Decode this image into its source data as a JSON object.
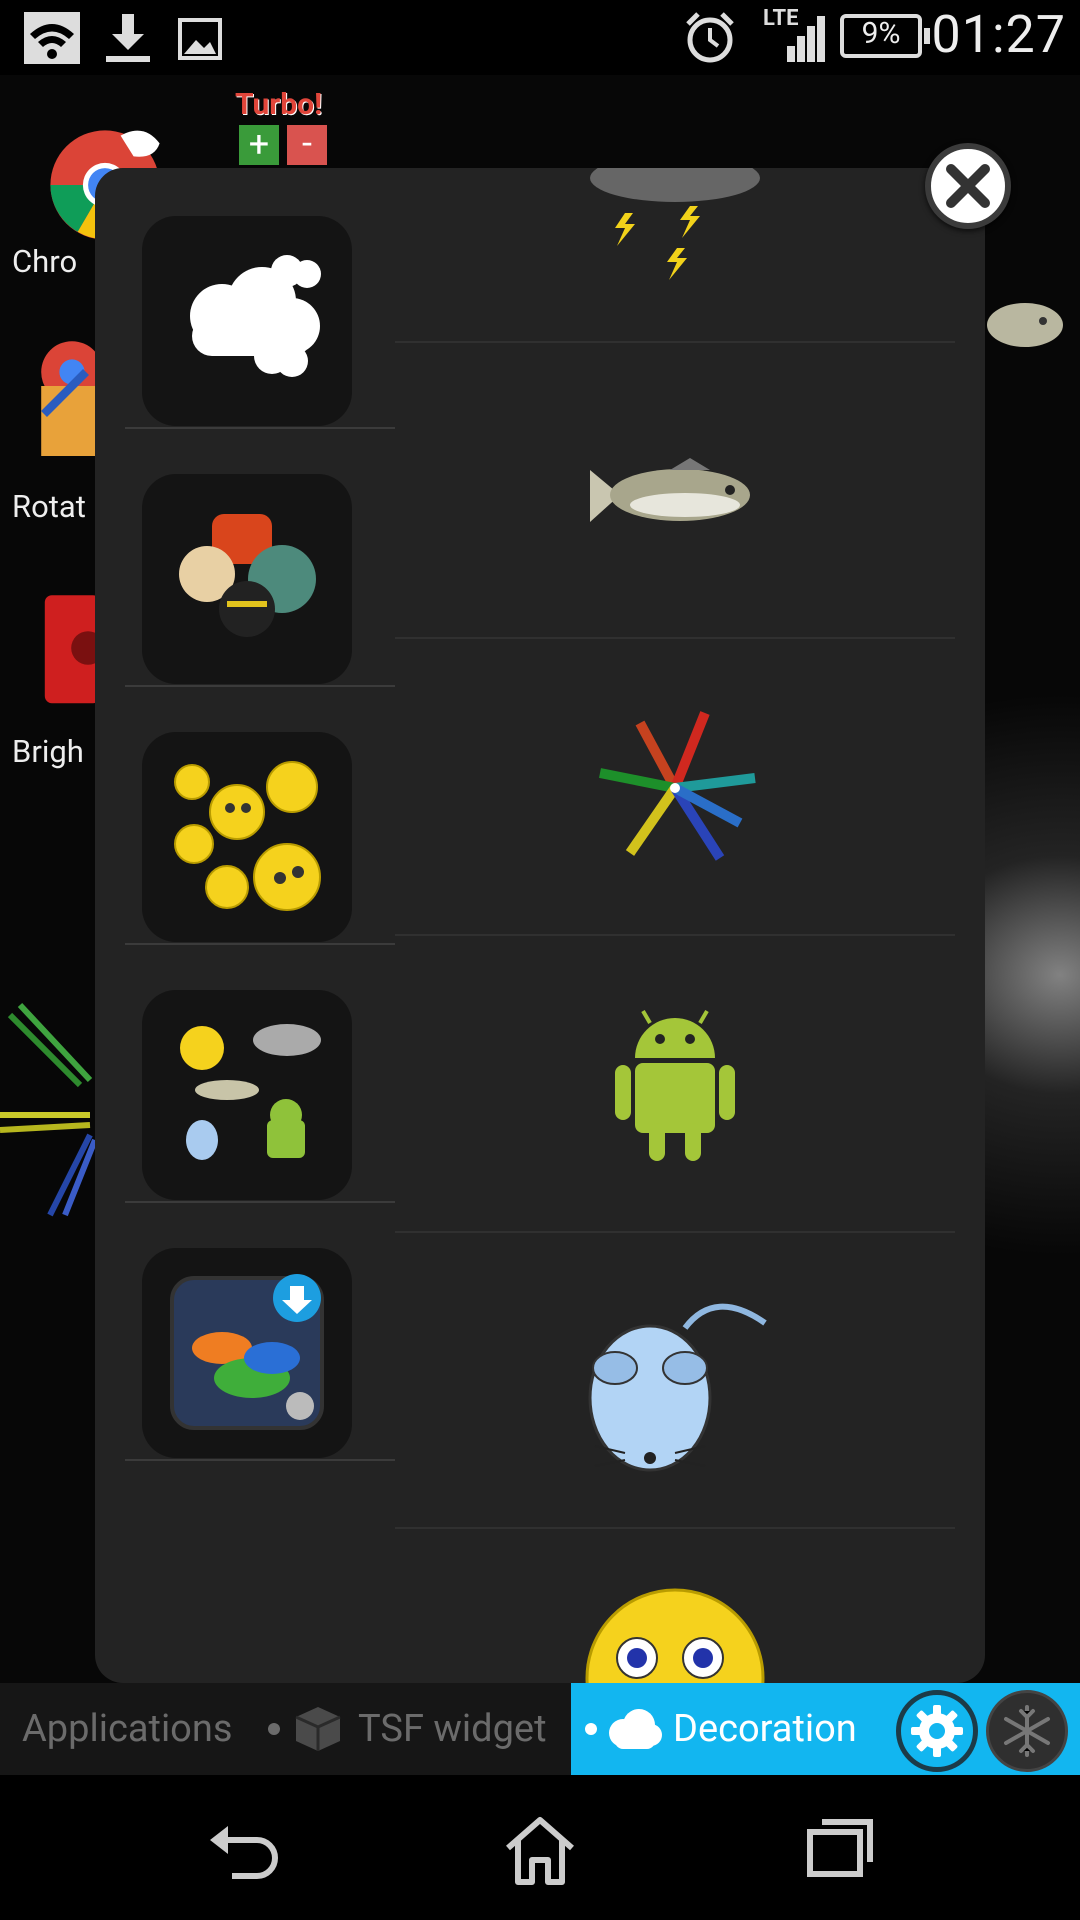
{
  "status_bar": {
    "time": "01:27",
    "battery_percent": "9%",
    "network_label": "LTE",
    "icons": [
      "wifi-icon",
      "download-icon",
      "image-icon",
      "alarm-icon",
      "signal-icon",
      "battery-icon"
    ]
  },
  "home_screen": {
    "apps": [
      {
        "label": "Chro",
        "icon": "chrome-icon"
      },
      {
        "label": "Rotat",
        "icon": "rotate-icon"
      },
      {
        "label": "Brigh",
        "icon": "brightness-icon"
      }
    ],
    "widget_label": "Turbo!"
  },
  "panel": {
    "left_items": [
      {
        "name": "clouds",
        "icon": "clouds-icon"
      },
      {
        "name": "animals",
        "icon": "animals-icon"
      },
      {
        "name": "smileys",
        "icon": "smileys-icon"
      },
      {
        "name": "mix",
        "icon": "mix-icon"
      },
      {
        "name": "fish-download",
        "icon": "fish-download-icon"
      }
    ],
    "previews": [
      "storm-cloud-icon",
      "fish-icon",
      "spring-star-icon",
      "android-robot-icon",
      "mouse-icon",
      "smiley-face-icon"
    ]
  },
  "tabs": {
    "applications": "Applications",
    "tsf_widget": "TSF widget",
    "decoration": "Decoration"
  },
  "colors": {
    "accent": "#12b6f0",
    "panel": "#232323",
    "android_green": "#a4c639"
  }
}
